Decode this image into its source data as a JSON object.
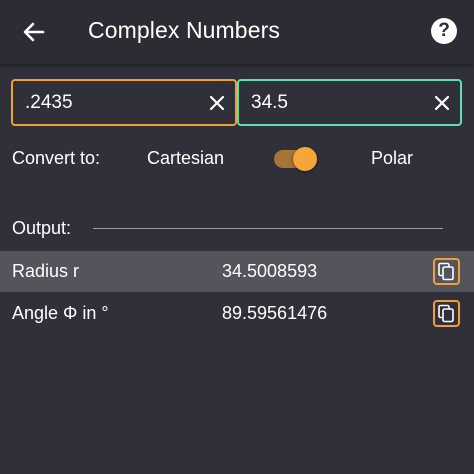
{
  "appbar": {
    "title": "Complex Numbers",
    "back_icon": "arrow-left-icon",
    "help_icon": "help-circle-icon",
    "help_glyph": "?"
  },
  "inputs": {
    "left": {
      "value": ".2435",
      "clear_icon": "close-icon"
    },
    "right": {
      "value": "34.5",
      "clear_icon": "close-icon"
    }
  },
  "convert": {
    "label": "Convert to:",
    "option_left": "Cartesian",
    "option_right": "Polar",
    "selected": "Polar"
  },
  "output": {
    "label": "Output:",
    "rows": [
      {
        "label": "Radius r",
        "value": "34.5008593",
        "copy_icon": "copy-icon"
      },
      {
        "label": "Angle Φ in °",
        "value": "89.59561476",
        "copy_icon": "copy-icon"
      }
    ]
  },
  "colors": {
    "background": "#2f3039",
    "appbar": "#2b2c34",
    "accent_orange": "#f0a132",
    "accent_green": "#5de0b0",
    "selected_row": "#53545c"
  }
}
